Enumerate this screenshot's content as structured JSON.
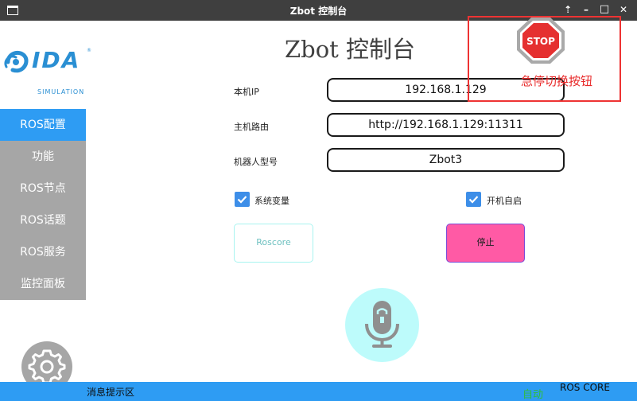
{
  "window": {
    "title": "Zbot 控制台",
    "up_glyph": "⇡",
    "min_glyph": "–",
    "max_glyph": "□",
    "close_glyph": "✕"
  },
  "logo": {
    "brand": "IDA",
    "sub": "SIMULATION",
    "reg": "®"
  },
  "sidebar": {
    "items": [
      {
        "label": "ROS配置",
        "active": true
      },
      {
        "label": "功能",
        "active": false
      },
      {
        "label": "ROS节点",
        "active": false
      },
      {
        "label": "ROS话题",
        "active": false
      },
      {
        "label": "ROS服务",
        "active": false
      },
      {
        "label": "监控面板",
        "active": false
      }
    ],
    "settings_icon": "gear-icon"
  },
  "main": {
    "title": "Zbot 控制台",
    "fields": {
      "ip": {
        "label": "本机IP",
        "value": "192.168.1.129"
      },
      "master": {
        "label": "主机路由",
        "value": "http://192.168.1.129:11311"
      },
      "robot": {
        "label": "机器人型号",
        "value": "Zbot3"
      }
    },
    "checkboxes": {
      "env": {
        "label": "系统变量",
        "checked": true
      },
      "autostart": {
        "label": "开机自启",
        "checked": true
      }
    },
    "roscore_button": "Roscore",
    "stop_button": "停止",
    "mic_icon": "microphone-icon"
  },
  "annotation": {
    "stop_sign_text": "STOP",
    "caption": "急停切换按钮"
  },
  "statusbar": {
    "hint": "消息提示区",
    "auto": "自动",
    "core": "ROS CORE"
  },
  "colors": {
    "accent": "#2e9cf3",
    "sidebar_inactive": "#a6a6a6",
    "stop_button": "#ff5aa5",
    "annotation": "#ee3333",
    "mic_bg": "#bdfbfb"
  }
}
